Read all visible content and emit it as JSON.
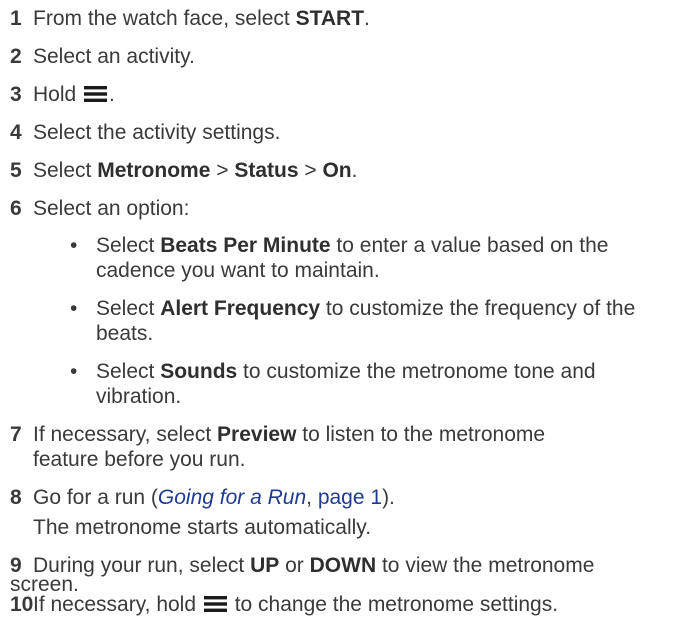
{
  "steps": [
    {
      "num": "1",
      "t1": "From the watch face, select ",
      "b1": "START",
      "t2": "."
    },
    {
      "num": "2",
      "t1": "Select an activity."
    },
    {
      "num": "3",
      "t1": "Hold ",
      "t2": "."
    },
    {
      "num": "4",
      "t1": "Select the activity settings."
    },
    {
      "num": "5",
      "t1": "Select ",
      "b1": "Metronome",
      "t2": " > ",
      "b2": "Status",
      "t3": " > ",
      "b3": "On",
      "t4": "."
    },
    {
      "num": "6",
      "t1": "Select an option:"
    },
    {
      "num": "7",
      "t1": "If necessary, select ",
      "b1": "Preview",
      "t2": " to listen to the metronome",
      "line2": "feature before you run."
    },
    {
      "num": "8",
      "t1": "Go for a run (",
      "link": "Going for a Run",
      "t2": ", ",
      "plink": "page 1",
      "t3": ").",
      "line2": "The metronome starts automatically."
    },
    {
      "num": "9",
      "t1": "During your run, select ",
      "b1": "UP",
      "t2": " or ",
      "b2": "DOWN",
      "t3": " to view the metronome",
      "line2": "screen."
    },
    {
      "num": "10",
      "t1": "If necessary, hold ",
      "t2": " to change the metronome settings."
    }
  ],
  "options": [
    {
      "bullet": "•",
      "t1": "Select ",
      "b1": "Beats Per Minute",
      "t2": " to enter a value based on the",
      "line2": "cadence you want to maintain."
    },
    {
      "bullet": "•",
      "t1": "Select ",
      "b1": "Alert Frequency",
      "t2": " to customize the frequency of the",
      "line2": "beats."
    },
    {
      "bullet": "•",
      "t1": "Select ",
      "b1": "Sounds",
      "t2": " to customize the metronome tone and",
      "line2": "vibration."
    }
  ],
  "icons": {
    "menu": "menu-icon"
  }
}
